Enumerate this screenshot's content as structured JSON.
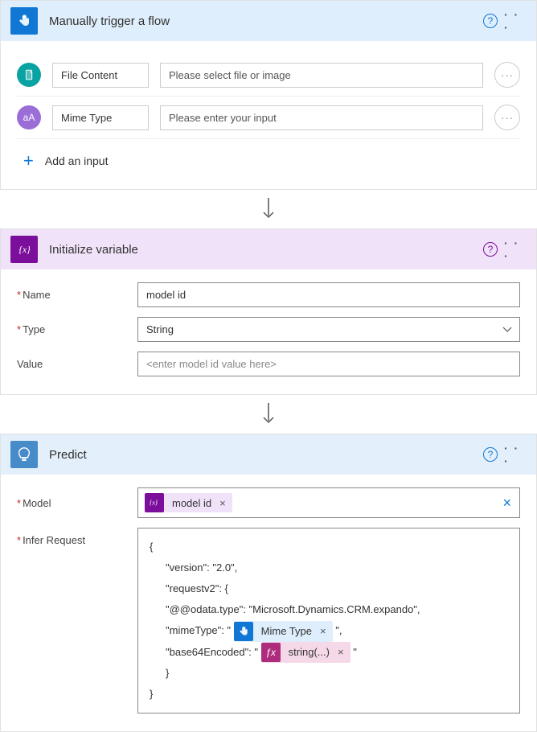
{
  "trigger": {
    "title": "Manually trigger a flow",
    "inputs": [
      {
        "icon": "file",
        "label": "File Content",
        "placeholder": "Please select file or image"
      },
      {
        "icon": "text",
        "label": "Mime Type",
        "placeholder": "Please enter your input"
      }
    ],
    "add_label": "Add an input"
  },
  "variable": {
    "title": "Initialize variable",
    "name_label": "Name",
    "name_value": "model id",
    "type_label": "Type",
    "type_value": "String",
    "value_label": "Value",
    "value_placeholder": "<enter model id value here>"
  },
  "predict": {
    "title": "Predict",
    "model_label": "Model",
    "model_token": "model id",
    "infer_label": "Infer Request",
    "json": {
      "l1": "{",
      "l2": "\"version\": \"2.0\",",
      "l3": "\"requestv2\": {",
      "l4": "\"@@odata.type\": \"Microsoft.Dynamics.CRM.expando\",",
      "l5a": "\"mimeType\": \"",
      "l5b": "\",",
      "l6a": "\"base64Encoded\": \"",
      "l6b": "\"",
      "l7": "}",
      "l8": "}",
      "mime_token": "Mime Type",
      "string_token": "string(...)"
    }
  }
}
